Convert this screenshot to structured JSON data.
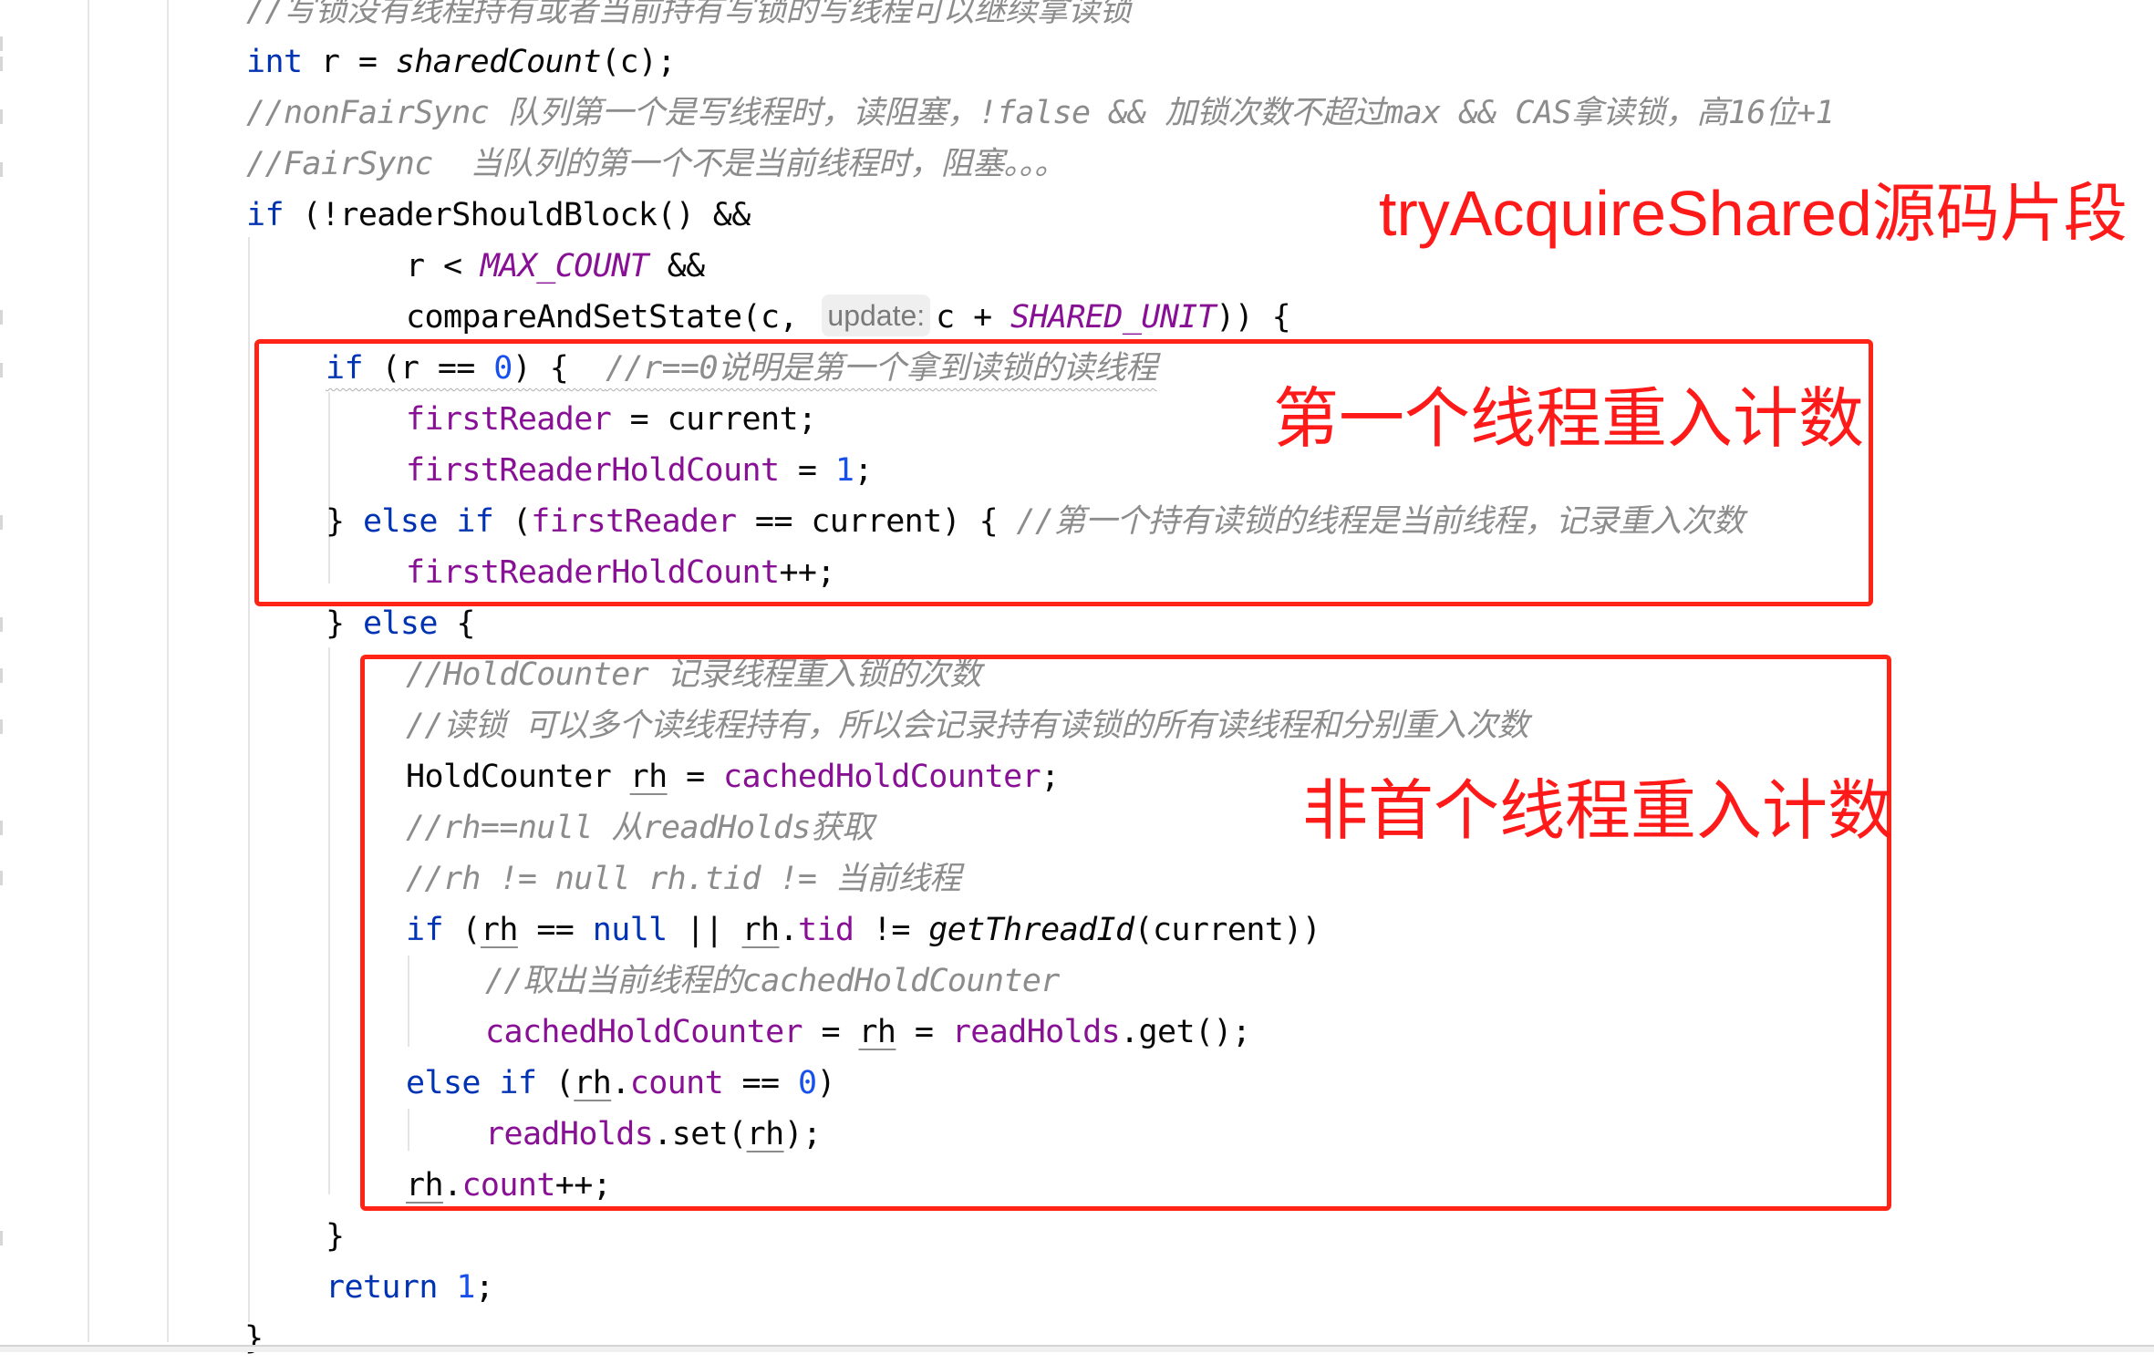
{
  "editor": {
    "language": "java",
    "colors": {
      "keyword": "#0033b3",
      "number": "#1750eb",
      "field": "#871094",
      "comment": "#8c8c8c",
      "annotation_red": "#ff1a1a"
    },
    "lines": {
      "l0": {
        "c1": "//写锁没有线程持有或者当前持有写锁的写线程可以继续拿读锁"
      },
      "l1": {
        "kw": "int",
        "t1": " r = ",
        "call": "sharedCount",
        "t2": "(c);"
      },
      "l2": {
        "c1": "//nonFairSync 队列第一个是写线程时，读阻塞，!false && 加锁次数不超过max && CAS拿读锁，高16位+1"
      },
      "l3": {
        "c1": "//FairSync  当队列的第一个不是当前线程时，阻塞。。。"
      },
      "l4": {
        "kw": "if",
        "t1": " (!readerShouldBlock() &&"
      },
      "l5": {
        "t1": "r < ",
        "const": "MAX_COUNT",
        "t2": " &&"
      },
      "l6": {
        "t1": "compareAndSetState(c, ",
        "hint": "update:",
        "t2": "c + ",
        "const": "SHARED_UNIT",
        "t3": ")) {"
      },
      "l7": {
        "kw": "if",
        "t1": " (r == ",
        "num": "0",
        "t2": ") {  ",
        "c1": "//r==0说明是第一个拿到读锁的读线程"
      },
      "l8": {
        "f1": "firstReader",
        "t1": " = current;"
      },
      "l9": {
        "f1": "firstReaderHoldCount",
        "t1": " = ",
        "num": "1",
        "t2": ";"
      },
      "l10": {
        "t1": "} ",
        "kw1": "else",
        "sp": " ",
        "kw2": "if",
        "t2": " (",
        "f1": "firstReader",
        "t3": " == current) { ",
        "c1": "//第一个持有读锁的线程是当前线程，记录重入次数"
      },
      "l11": {
        "f1": "firstReaderHoldCount",
        "t1": "++;"
      },
      "l12": {
        "t1": "} ",
        "kw": "else",
        "t2": " {"
      },
      "l13": {
        "c1": "//HoldCounter 记录线程重入锁的次数"
      },
      "l14": {
        "c1": "//读锁 可以多个读线程持有，所以会记录持有读锁的所有读线程和分别重入次数"
      },
      "l15": {
        "t1": "HoldCounter ",
        "v1": "rh",
        "t2": " = ",
        "f1": "cachedHoldCounter",
        "t3": ";"
      },
      "l16": {
        "c1": "//rh==null 从readHolds获取"
      },
      "l17": {
        "c1": "//rh != null rh.tid != 当前线程"
      },
      "l18": {
        "kw1": "if",
        "t1": " (",
        "v1": "rh",
        "t2": " == ",
        "kw2": "null",
        "t3": " || ",
        "v2": "rh",
        "t4": ".",
        "f1": "tid",
        "t5": " != ",
        "call": "getThreadId",
        "t6": "(current))"
      },
      "l19": {
        "c1": "//取出当前线程的cachedHoldCounter"
      },
      "l20": {
        "f1": "cachedHoldCounter",
        "t1": " = ",
        "v1": "rh",
        "t2": " = ",
        "f2": "readHolds",
        "t3": ".get();"
      },
      "l21": {
        "kw1": "else",
        "sp": " ",
        "kw2": "if",
        "t1": " (",
        "v1": "rh",
        "t2": ".",
        "f1": "count",
        "t3": " == ",
        "num": "0",
        "t4": ")"
      },
      "l22": {
        "f1": "readHolds",
        "t1": ".set(",
        "v1": "rh",
        "t2": ");"
      },
      "l23": {
        "v1": "rh",
        "t1": ".",
        "f1": "count",
        "t2": "++;"
      },
      "l24": {
        "t1": "}"
      },
      "l25": {
        "kw": "return",
        "sp": " ",
        "num": "1",
        "t1": ";"
      },
      "l26": {
        "t1": "}"
      }
    }
  },
  "annotations": {
    "title": "tryAcquireShared源码片段",
    "box1_label": "第一个线程重入计数",
    "box2_label": "非首个线程重入计数"
  }
}
